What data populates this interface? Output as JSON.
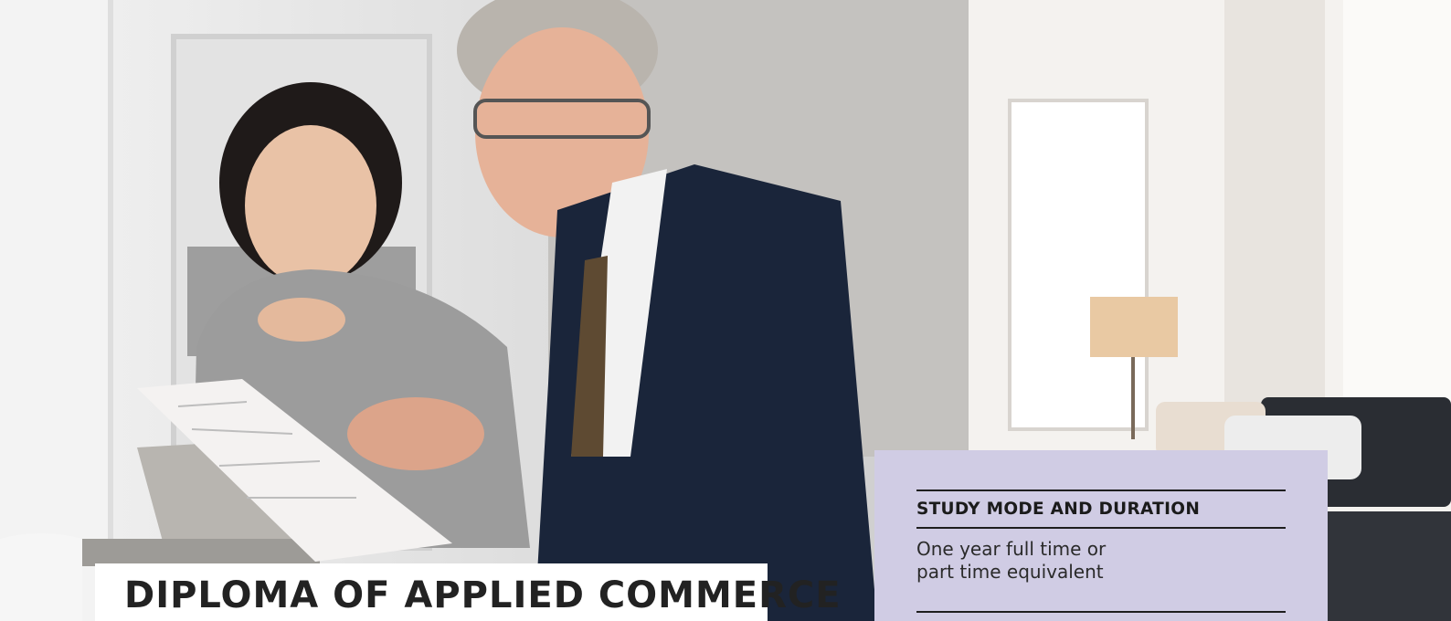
{
  "hero": {
    "image_subject": "Two people reviewing a document at a laptop in a bright living room"
  },
  "title_card": {
    "title": "DIPLOMA OF APPLIED COMMERCE"
  },
  "info_card": {
    "label": "STUDY MODE AND DURATION",
    "value_line_1": "One year full time or",
    "value_line_2": "part time equivalent"
  },
  "colors": {
    "info_card_bg": "#d0cce4",
    "title_card_bg": "#ffffff",
    "text_dark": "#1e1e1e"
  }
}
